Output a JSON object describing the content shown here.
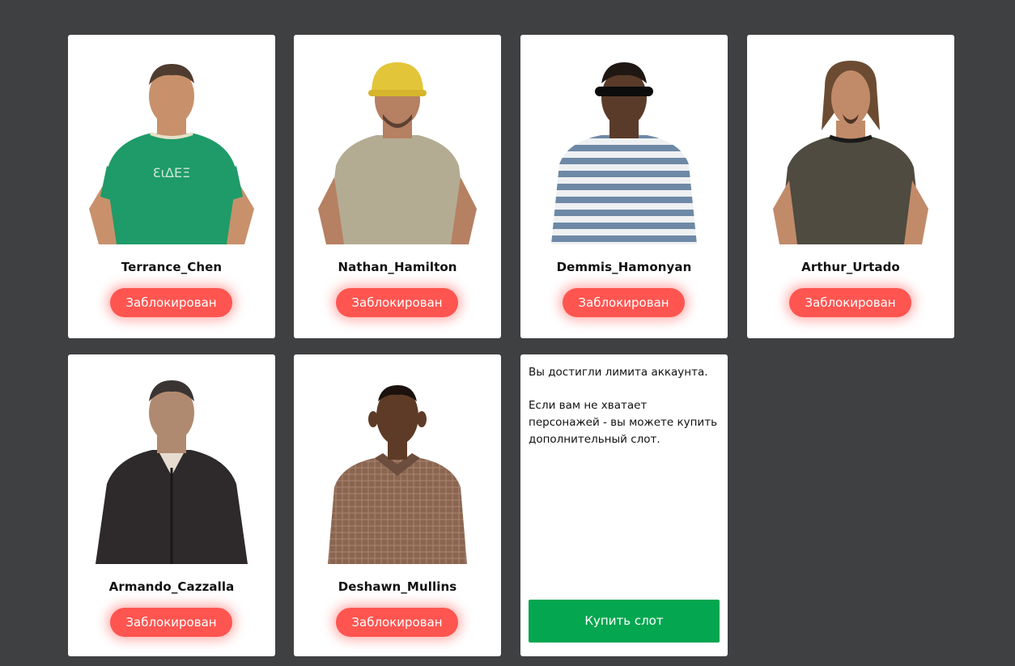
{
  "colors": {
    "background": "#3f4042",
    "card": "#ffffff",
    "locked_button": "#ff5550",
    "buy_button": "#04a650"
  },
  "characters": [
    {
      "name": "Terrance_Chen",
      "status": "Заблокирован",
      "image": "character-portrait-green-tshirt"
    },
    {
      "name": "Nathan_Hamilton",
      "status": "Заблокирован",
      "image": "character-portrait-hardhat"
    },
    {
      "name": "Demmis_Hamonyan",
      "status": "Заблокирован",
      "image": "character-portrait-striped-shirt"
    },
    {
      "name": "Arthur_Urtado",
      "status": "Заблокирован",
      "image": "character-portrait-dark-tshirt"
    },
    {
      "name": "Armando_Cazzalla",
      "status": "Заблокирован",
      "image": "character-portrait-leather-jacket"
    },
    {
      "name": "Deshawn_Mullins",
      "status": "Заблокирован",
      "image": "character-portrait-plaid-shirt"
    }
  ],
  "limit_panel": {
    "line1": "Вы достигли лимита аккаунта.",
    "line2": "Если вам не хватает персонажей - вы можете купить дополнительный слот.",
    "buy_label": "Купить слот"
  }
}
